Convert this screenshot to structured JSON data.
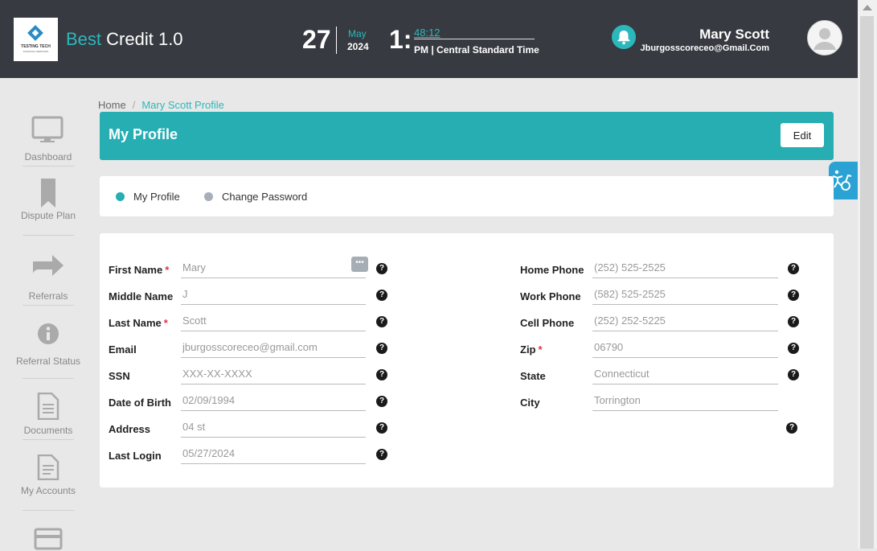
{
  "header": {
    "logo_line1": "TESTING TECH",
    "logo_line2": "FINANCIAL SERVICES",
    "app_title_accent": "Best",
    "app_title_rest": "Credit 1.0",
    "date_day": "27",
    "date_month": "May",
    "date_year": "2024",
    "time_hour": "1:",
    "time_minsec": "48:12",
    "time_ampm": "PM",
    "time_zone": "Central Standard Time",
    "user_name": "Mary Scott",
    "user_email": "Jburgosscoreceo@Gmail.Com"
  },
  "sidebar": {
    "items": [
      {
        "label": "Dashboard",
        "icon": "monitor-icon"
      },
      {
        "label": "Dispute Plan",
        "icon": "bookmark-icon"
      },
      {
        "label": "Referrals",
        "icon": "share-arrow-icon"
      },
      {
        "label": "Referral Status",
        "icon": "info-circle-icon"
      },
      {
        "label": "Documents",
        "icon": "document-icon"
      },
      {
        "label": "My Accounts",
        "icon": "file-list-icon"
      },
      {
        "label": "",
        "icon": "credit-card-icon"
      }
    ]
  },
  "breadcrumb": {
    "home": "Home",
    "separator": "/",
    "current": "Mary Scott Profile"
  },
  "profile": {
    "title": "My Profile",
    "edit_label": "Edit"
  },
  "tabs": [
    {
      "label": "My Profile",
      "active": true
    },
    {
      "label": "Change Password",
      "active": false
    }
  ],
  "form": {
    "left": [
      {
        "label": "First Name",
        "required": true,
        "value": "Mary"
      },
      {
        "label": "Middle Name",
        "required": false,
        "value": "J"
      },
      {
        "label": "Last Name",
        "required": true,
        "value": "Scott"
      },
      {
        "label": "Email",
        "required": false,
        "value": "jburgosscoreceo@gmail.com"
      },
      {
        "label": "SSN",
        "required": false,
        "value": "",
        "placeholder": "XXX-XX-XXXX"
      },
      {
        "label": "Date of Birth",
        "required": false,
        "value": "02/09/1994"
      },
      {
        "label": "Address",
        "required": false,
        "value": "04 st"
      },
      {
        "label": "Last Login",
        "required": false,
        "value": "05/27/2024"
      }
    ],
    "right": [
      {
        "label": "Home Phone",
        "required": false,
        "value": "(252) 525-2525"
      },
      {
        "label": "Work Phone",
        "required": false,
        "value": "(582) 525-2525"
      },
      {
        "label": "Cell Phone",
        "required": false,
        "value": "(252) 252-5225"
      },
      {
        "label": "Zip",
        "required": true,
        "value": "06790"
      },
      {
        "label": "State",
        "required": false,
        "value": "Connecticut"
      },
      {
        "label": "City",
        "required": false,
        "value": "Torrington"
      }
    ],
    "help_glyph": "?",
    "required_mark": "*"
  },
  "colors": {
    "topbar": "#373a40",
    "accent": "#26aeb3",
    "required": "#e0334a",
    "a11y": "#2aa3d4"
  }
}
